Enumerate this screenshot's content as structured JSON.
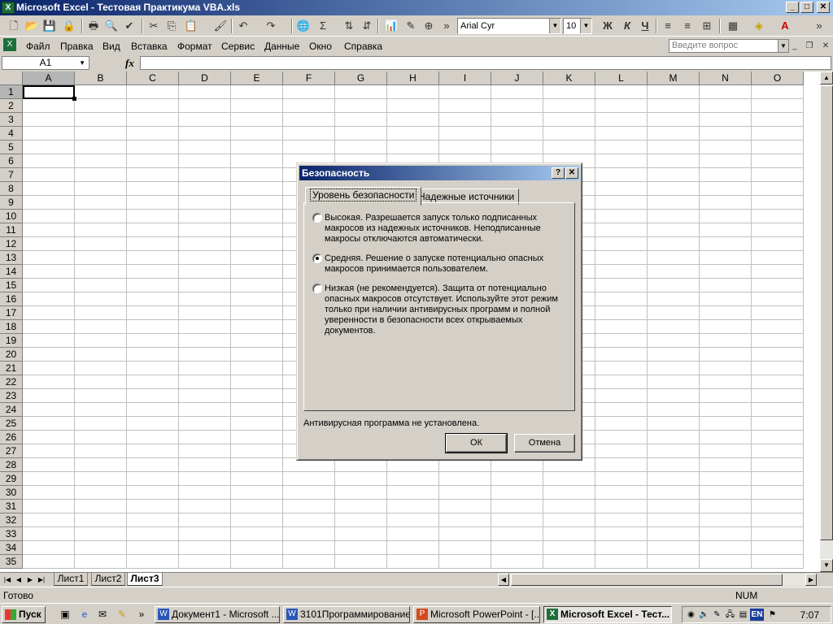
{
  "window": {
    "title": "Microsoft Excel - Тестовая Практикума VBA.xls",
    "app_icon": "X"
  },
  "toolbar": {
    "font_name": "Arial Cyr",
    "font_size": "10",
    "bold": "Ж",
    "italic": "К",
    "underline": "Ч",
    "sigma": "Σ",
    "overflow": "»"
  },
  "menu": {
    "items": [
      "Файл",
      "Правка",
      "Вид",
      "Вставка",
      "Формат",
      "Сервис",
      "Данные",
      "Окно",
      "Справка"
    ],
    "help_placeholder": "Введите вопрос"
  },
  "formula_bar": {
    "cell_ref": "A1",
    "fx": "fx",
    "value": ""
  },
  "grid": {
    "columns": [
      "A",
      "B",
      "C",
      "D",
      "E",
      "F",
      "G",
      "H",
      "I",
      "J",
      "K",
      "L",
      "M",
      "N",
      "O"
    ],
    "rows": [
      "1",
      "2",
      "3",
      "4",
      "5",
      "6",
      "7",
      "8",
      "9",
      "10",
      "11",
      "12",
      "13",
      "14",
      "15",
      "16",
      "17",
      "18",
      "19",
      "20",
      "21",
      "22",
      "23",
      "24",
      "25",
      "26",
      "27",
      "28",
      "29",
      "30",
      "31",
      "32",
      "33",
      "34",
      "35"
    ]
  },
  "sheets": {
    "tabs": [
      "Лист1",
      "Лист2",
      "Лист3"
    ],
    "active": "Лист3"
  },
  "status": {
    "text": "Готово",
    "num": "NUM"
  },
  "taskbar": {
    "start": "Пуск",
    "buttons": [
      "Документ1 - Microsoft ...",
      "3101Программирование...",
      "Microsoft PowerPoint - [...",
      "Microsoft Excel - Тест..."
    ],
    "lang": "EN",
    "clock": "7:07"
  },
  "dialog": {
    "title": "Безопасность",
    "tabs": [
      "Уровень безопасности",
      "Надежные источники"
    ],
    "options": [
      {
        "label": "Высокая. Разрешается запуск только подписанных макросов из надежных источников. Неподписанные макросы отключаются автоматически.",
        "checked": false
      },
      {
        "label": "Средняя. Решение о запуске потенциально опасных макросов принимается пользователем.",
        "checked": true
      },
      {
        "label": "Низкая (не рекомендуется). Защита от потенциально опасных макросов отсутствует. Используйте этот режим только при наличии антивирусных программ и полной уверенности в безопасности всех открываемых документов.",
        "checked": false
      }
    ],
    "note": "Антивирусная программа не установлена.",
    "ok": "ОК",
    "cancel": "Отмена",
    "help_btn": "?",
    "close_btn": "✕"
  },
  "colors": {
    "title_start": "#0a246a",
    "title_end": "#a6caf0",
    "face": "#d4d0c8"
  }
}
